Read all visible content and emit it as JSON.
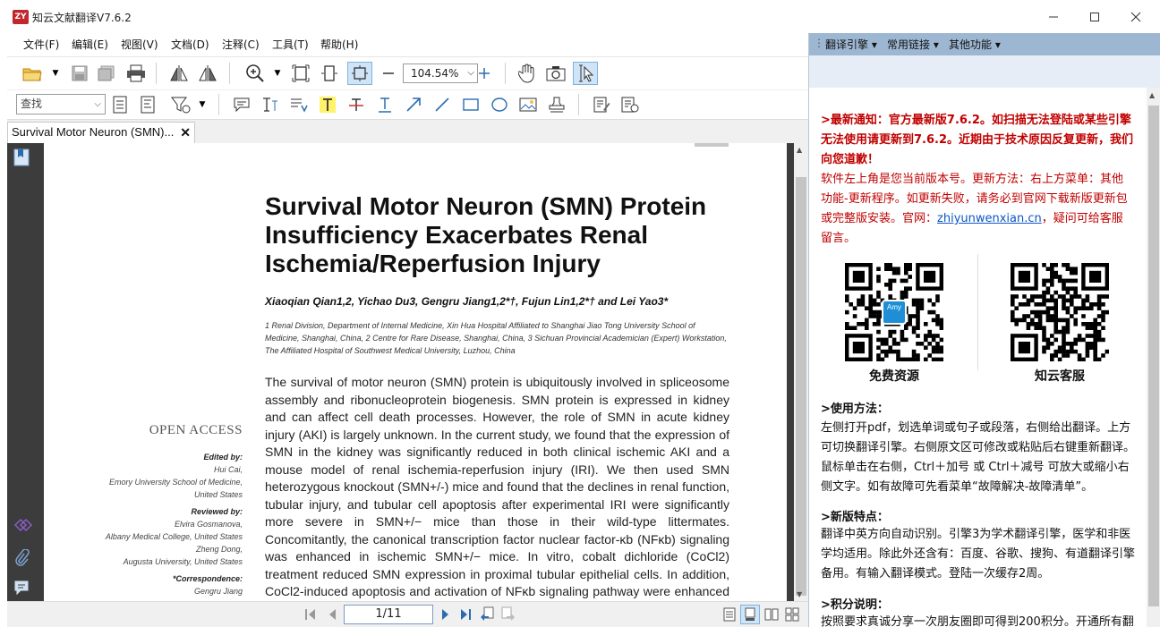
{
  "window": {
    "logo": "ZY",
    "title": "知云文献翻译V7.6.2"
  },
  "menu": [
    "文件(F)",
    "编辑(E)",
    "视图(V)",
    "文档(D)",
    "注释(C)",
    "工具(T)",
    "帮助(H)"
  ],
  "toolbar": {
    "zoom_value": "104.54%"
  },
  "toolbar2": {
    "search_value": "查找"
  },
  "tab": {
    "label": "Survival Motor Neuron (SMN)...",
    "close": "✕"
  },
  "pager": {
    "current": "1/11"
  },
  "paper": {
    "title": "Survival Motor Neuron (SMN) Protein Insufficiency Exacerbates Renal Ischemia/Reperfusion Injury",
    "authors": "Xiaoqian Qian1,2, Yichao Du3, Gengru Jiang1,2*†, Fujun Lin1,2*† and Lei Yao3*",
    "affiliations": "1 Renal Division, Department of Internal Medicine, Xin Hua Hospital Affiliated to Shanghai Jiao Tong University School of Medicine, Shanghai, China, 2 Centre for Rare Disease, Shanghai, China, 3 Sichuan Provincial Academician (Expert) Workstation, The Affiliated Hospital of Southwest Medical University, Luzhou, China",
    "abstract": "The survival of motor neuron (SMN) protein is ubiquitously involved in spliceosome assembly and ribonucleoprotein biogenesis. SMN protein is expressed in kidney and can affect cell death processes. However, the role of SMN in acute kidney injury (AKI) is largely unknown. In the current study, we found that the expression of SMN in the kidney was significantly reduced in both clinical ischemic AKI and a mouse model of renal ischemia-reperfusion injury (IRI). We then used SMN heterozygous knockout (SMN+/-) mice and found that the declines in renal function, tubular injury, and tubular cell apoptosis after experimental IRI were significantly more severe in SMN+/− mice than those in their wild-type littermates. Concomitantly, the canonical transcription factor nuclear factor-κb (NFκb) signaling was enhanced in ischemic SMN+/− mice. In vitro, cobalt dichloride (CoCl2) treatment reduced SMN expression in proximal tubular epithelial cells. In addition, CoCl2-induced apoptosis and activation of NFκb signaling pathway were enhanced by transient transfection of a small-interfering RNA (siRNA)",
    "open_access": "OPEN ACCESS",
    "edited_by_label": "Edited by:",
    "edited_by": [
      "Hui Cai,",
      "Emory University School of Medicine,",
      "United States"
    ],
    "reviewed_by_label": "Reviewed by:",
    "reviewed_by": [
      "Elvira Gosmanova,",
      "Albany Medical College, United States",
      "Zheng Dong,",
      "Augusta University, United States"
    ],
    "correspondence_label": "*Correspondence:",
    "correspondence": [
      "Gengru Jiang"
    ]
  },
  "right_panel": {
    "menu": [
      "翻译引擎 ▾",
      "常用链接 ▾",
      "其他功能 ▾"
    ],
    "notice": ">最新通知：官方最新版7.6.2。如扫描无法登陆或某些引擎无法使用请更新到7.6.2。近期由于技术原因反复更新，我们向您道歉！",
    "update_text": "软件左上角是您当前版本号。更新方法：右上方菜单：其他功能-更新程序。如更新失败，请务必到官网下载新版更新包或完整版安装。官网：",
    "update_link": "zhiyunwenxian.cn",
    "update_tail": "，疑问可给客服留言。",
    "qr_left_caption": "免费资源",
    "qr_right_caption": "知云客服",
    "qr_badge": "Amy",
    "usage_title": ">使用方法：",
    "usage_body": "左侧打开pdf，划选单词或句子或段落，右侧给出翻译。上方可切换翻译引擎。右侧原文区可修改或粘贴后右键重新翻译。鼠标单击在右侧，Ctrl＋加号 或 Ctrl＋减号 可放大或缩小右侧文字。如有故障可先看菜单“故障解决-故障清单”。",
    "features_title": ">新版特点：",
    "features_body": "翻译中英方向自动识别。引擎3为学术翻译引擎，医学和非医学均适用。除此外还含有：百度、谷歌、搜狗、有道翻译引擎备用。有输入翻译模式。登陆一次缓存2周。",
    "points_title": ">积分说明：",
    "points_body": "按照要求真诚分享一次朋友圈即可得到200积分。开通所有翻"
  }
}
